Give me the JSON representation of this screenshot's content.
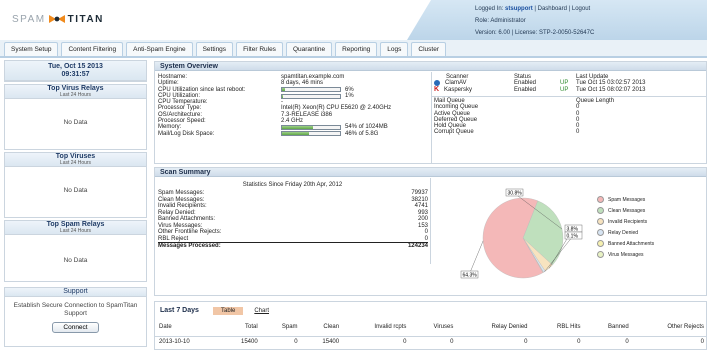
{
  "header": {
    "brand_left": "SPAM",
    "brand_right": "TITAN",
    "logged_in_label": "Logged In:",
    "user": "stsupport",
    "links": [
      "Dashboard",
      "Logout"
    ],
    "role": "Role: Administrator",
    "version": "Version: 6.00",
    "license": "License: STP-2-0050-52647C"
  },
  "tabs": [
    "System Setup",
    "Content Filtering",
    "Anti-Spam Engine",
    "Settings",
    "Filter Rules",
    "Quarantine",
    "Reporting",
    "Logs",
    "Cluster"
  ],
  "left": {
    "date": "Tue, Oct 15 2013",
    "time": "09:31:57",
    "virus_relays": {
      "title": "Top Virus Relays",
      "subtitle": "Last 24 Hours",
      "body": "No Data"
    },
    "viruses": {
      "title": "Top Viruses",
      "subtitle": "Last 24 Hours",
      "body": "No Data"
    },
    "spam_relays": {
      "title": "Top Spam Relays",
      "subtitle": "Last 24 Hours",
      "body": "No Data"
    },
    "support": {
      "title": "Support",
      "text": "Establish Secure Connection to SpamTitan Support",
      "button": "Connect"
    }
  },
  "overview": {
    "title": "System Overview",
    "rows": [
      {
        "k": "Hostname:",
        "v": "spamtitan.example.com"
      },
      {
        "k": "Uptime:",
        "v": "8 days, 46 mins"
      },
      {
        "k": "CPU Utilization since last reboot:",
        "v": "6%",
        "bar": 0.06
      },
      {
        "k": "CPU Utilization:",
        "v": "1%",
        "bar": 0.01
      },
      {
        "k": "CPU Temperature:",
        "v": "-"
      },
      {
        "k": "Processor Type:",
        "v": "Intel(R) Xeon(R) CPU E5620 @ 2.40GHz"
      },
      {
        "k": "OS/Architecture:",
        "v": "7.3-RELEASE i386"
      },
      {
        "k": "Processor Speed:",
        "v": "2.4 GHz"
      },
      {
        "k": "Memory:",
        "v": "54% of 1024MB",
        "bar": 0.54
      },
      {
        "k": "Mail/Log Disk Space:",
        "v": "46% of 5.8G",
        "bar": 0.46
      }
    ],
    "scanner_headers": [
      "Scanner",
      "Status",
      "",
      "Last Update"
    ],
    "scanners": [
      {
        "name": "ClamAV",
        "status": "Enabled",
        "state": "UP",
        "update": "Tue Oct 15 03:02:57 2013"
      },
      {
        "name": "Kaspersky",
        "status": "Enabled",
        "state": "UP",
        "update": "Tue Oct 15 08:02:07 2013"
      }
    ],
    "queue_headers": [
      "Mail Queue",
      "Queue Length"
    ],
    "queues": [
      {
        "name": "Incoming Queue",
        "len": "0"
      },
      {
        "name": "Active Queue",
        "len": "0"
      },
      {
        "name": "Deferred Queue",
        "len": "0"
      },
      {
        "name": "Hold Queue",
        "len": "0"
      },
      {
        "name": "Corrupt Queue",
        "len": "0"
      }
    ]
  },
  "scan": {
    "title": "Scan Summary",
    "since": "Statistics Since Friday 20th Apr, 2012",
    "rows": [
      {
        "k": "Spam Messages:",
        "v": "79937"
      },
      {
        "k": "Clean Messages:",
        "v": "38210"
      },
      {
        "k": "Invalid Recipients:",
        "v": "4741"
      },
      {
        "k": "Relay Denied:",
        "v": "993"
      },
      {
        "k": "Banned Attachments:",
        "v": "200"
      },
      {
        "k": "Virus Messages:",
        "v": "153"
      },
      {
        "k": "Other Frontline Rejects:",
        "v": "0"
      },
      {
        "k": "RBL Reject",
        "v": "0"
      }
    ],
    "total": {
      "k": "Messages Processed:",
      "v": "124234"
    }
  },
  "chart_data": {
    "type": "pie",
    "slices": [
      {
        "name": "Spam Messages",
        "value": 64.3,
        "color": "#f4b8b8"
      },
      {
        "name": "Clean Messages",
        "value": 30.8,
        "color": "#bfe0bd"
      },
      {
        "name": "Invalid Recipients",
        "value": 3.8,
        "color": "#f7e3bf"
      },
      {
        "name": "Relay Denied",
        "value": 0.8,
        "color": "#d7e4f2"
      },
      {
        "name": "Banned Attachments",
        "value": 0.2,
        "color": "#f6f0b0"
      },
      {
        "name": "Virus Messages",
        "value": 0.1,
        "color": "#e8f2c4"
      }
    ],
    "labels": [
      "64.3%",
      "30.8%",
      "3.8%",
      "0.1%"
    ]
  },
  "days": {
    "title": "Last 7 Days",
    "tab_table": "Table",
    "tab_chart": "Chart",
    "headers": [
      "Date",
      "Total",
      "Spam",
      "Clean",
      "Invalid rcpts",
      "Viruses",
      "Relay Denied",
      "RBL Hits",
      "Banned",
      "Other Rejects"
    ],
    "rows": [
      [
        "2013-10-10",
        "15400",
        "0",
        "15400",
        "0",
        "0",
        "0",
        "0",
        "0",
        "0"
      ]
    ]
  }
}
